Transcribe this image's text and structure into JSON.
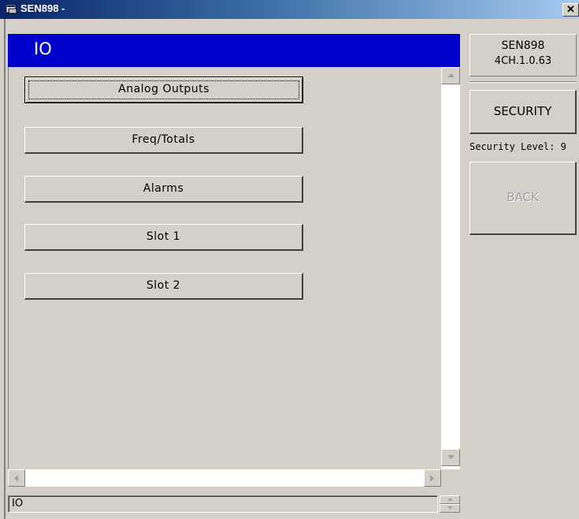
{
  "window": {
    "title": "SEN898 -",
    "close_glyph": "✕"
  },
  "header": {
    "title": "IO"
  },
  "menu": {
    "items": [
      {
        "label": "Analog Outputs",
        "focused": true
      },
      {
        "label": "Freq/Totals",
        "focused": false
      },
      {
        "label": "Alarms",
        "focused": false
      },
      {
        "label": "Slot 1",
        "focused": false
      },
      {
        "label": "Slot 2",
        "focused": false
      }
    ]
  },
  "status": {
    "value": "IO"
  },
  "side": {
    "device": "SEN898",
    "version": "4CH.1.0.63",
    "security_button": "SECURITY",
    "security_level": "Security Level: 9",
    "back_button": "BACK",
    "back_enabled": false
  },
  "colors": {
    "header_bg": "#0000cc",
    "window_bg": "#d4d0c8",
    "title_gradient_start": "#0a246a"
  },
  "icons": {
    "app": "window-app-icon",
    "close": "close-icon",
    "scroll_up": "arrow-up-icon",
    "scroll_down": "arrow-down-icon",
    "scroll_left": "arrow-left-icon",
    "scroll_right": "arrow-right-icon",
    "spin_up": "spin-up-icon",
    "spin_down": "spin-down-icon"
  }
}
